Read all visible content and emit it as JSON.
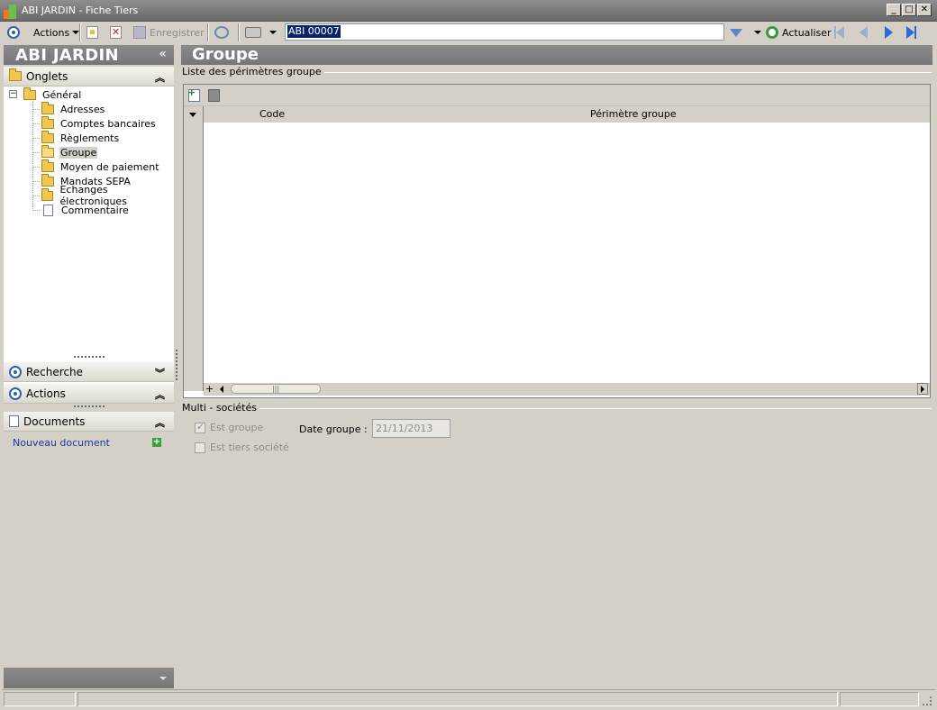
{
  "window": {
    "title": "ABI JARDIN - Fiche Tiers",
    "controls": {
      "minimize": "_",
      "maximize": "□",
      "close": "✕"
    }
  },
  "toolbar": {
    "actions_label": "Actions",
    "save_label": "Enregistrer",
    "record_value": "ABI 00007",
    "refresh_label": "Actualiser"
  },
  "left_panel": {
    "brand": "ABI JARDIN",
    "collapse_glyph": "«",
    "onglets_label": "Onglets",
    "tree": {
      "root": "Général",
      "items": [
        {
          "label": "Adresses",
          "icon": "folder-icon"
        },
        {
          "label": "Comptes bancaires",
          "icon": "folder-icon"
        },
        {
          "label": "Règlements",
          "icon": "folder-icon"
        },
        {
          "label": "Groupe",
          "icon": "folder-open-icon",
          "selected": true
        },
        {
          "label": "Moyen de paiement",
          "icon": "folder-icon"
        },
        {
          "label": "Mandats SEPA",
          "icon": "folder-icon"
        },
        {
          "label": "Echanges électroniques",
          "icon": "folder-icon"
        },
        {
          "label": "Commentaire",
          "icon": "document-icon"
        }
      ]
    },
    "recherche_label": "Recherche",
    "actions_label": "Actions",
    "documents_label": "Documents",
    "new_document_label": "Nouveau document"
  },
  "main": {
    "title": "Groupe",
    "list_legend": "Liste des périmètres groupe",
    "grid": {
      "columns": [
        "Code",
        "Périmètre groupe"
      ],
      "rows": []
    },
    "multi": {
      "legend": "Multi - sociétés",
      "est_groupe_label": "Est groupe",
      "est_groupe_checked": true,
      "est_tiers_label": "Est tiers société",
      "est_tiers_checked": false,
      "date_label": "Date groupe :",
      "date_value": "21/11/2013"
    }
  },
  "colors": {
    "header_gray": "#767676",
    "window_bg": "#d4d0c8",
    "accent_blue": "#2f5fb0",
    "link_blue": "#1a3aa0"
  }
}
